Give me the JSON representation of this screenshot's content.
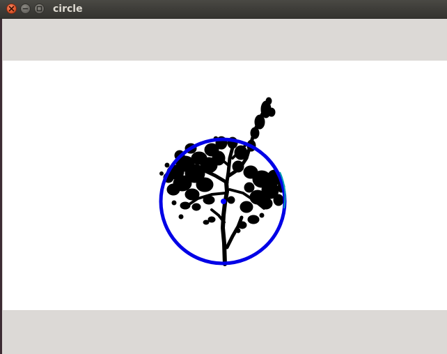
{
  "window": {
    "title": "circle",
    "buttons": {
      "close": "close-icon",
      "minimize": "minimize-icon",
      "maximize": "maximize-icon"
    }
  },
  "image": {
    "subject": "tree-silhouette",
    "circle_color": "#0000e6",
    "center_point_color": "#0000ff",
    "silhouette_color": "#000000",
    "background": "#ffffff"
  }
}
